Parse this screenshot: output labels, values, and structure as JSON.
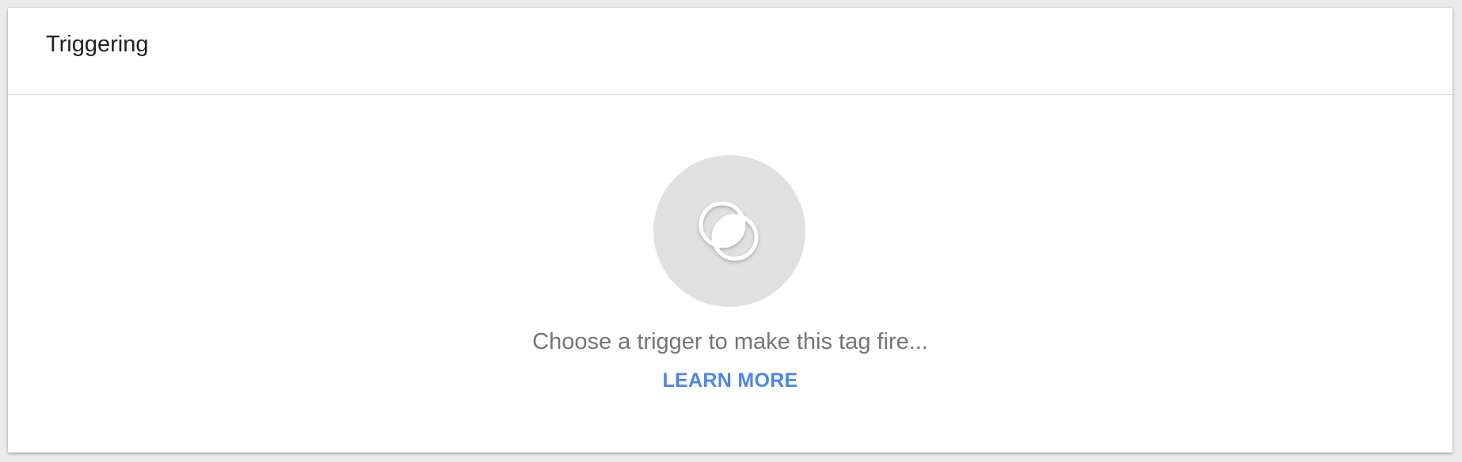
{
  "card": {
    "title": "Triggering"
  },
  "empty_state": {
    "icon": "trigger-icon",
    "message": "Choose a trigger to make this tag fire...",
    "link_label": "LEARN MORE"
  },
  "colors": {
    "accent": "#4a86e8",
    "icon_circle": "#e0e0e0",
    "message_text": "#757575",
    "title_text": "#212121"
  }
}
